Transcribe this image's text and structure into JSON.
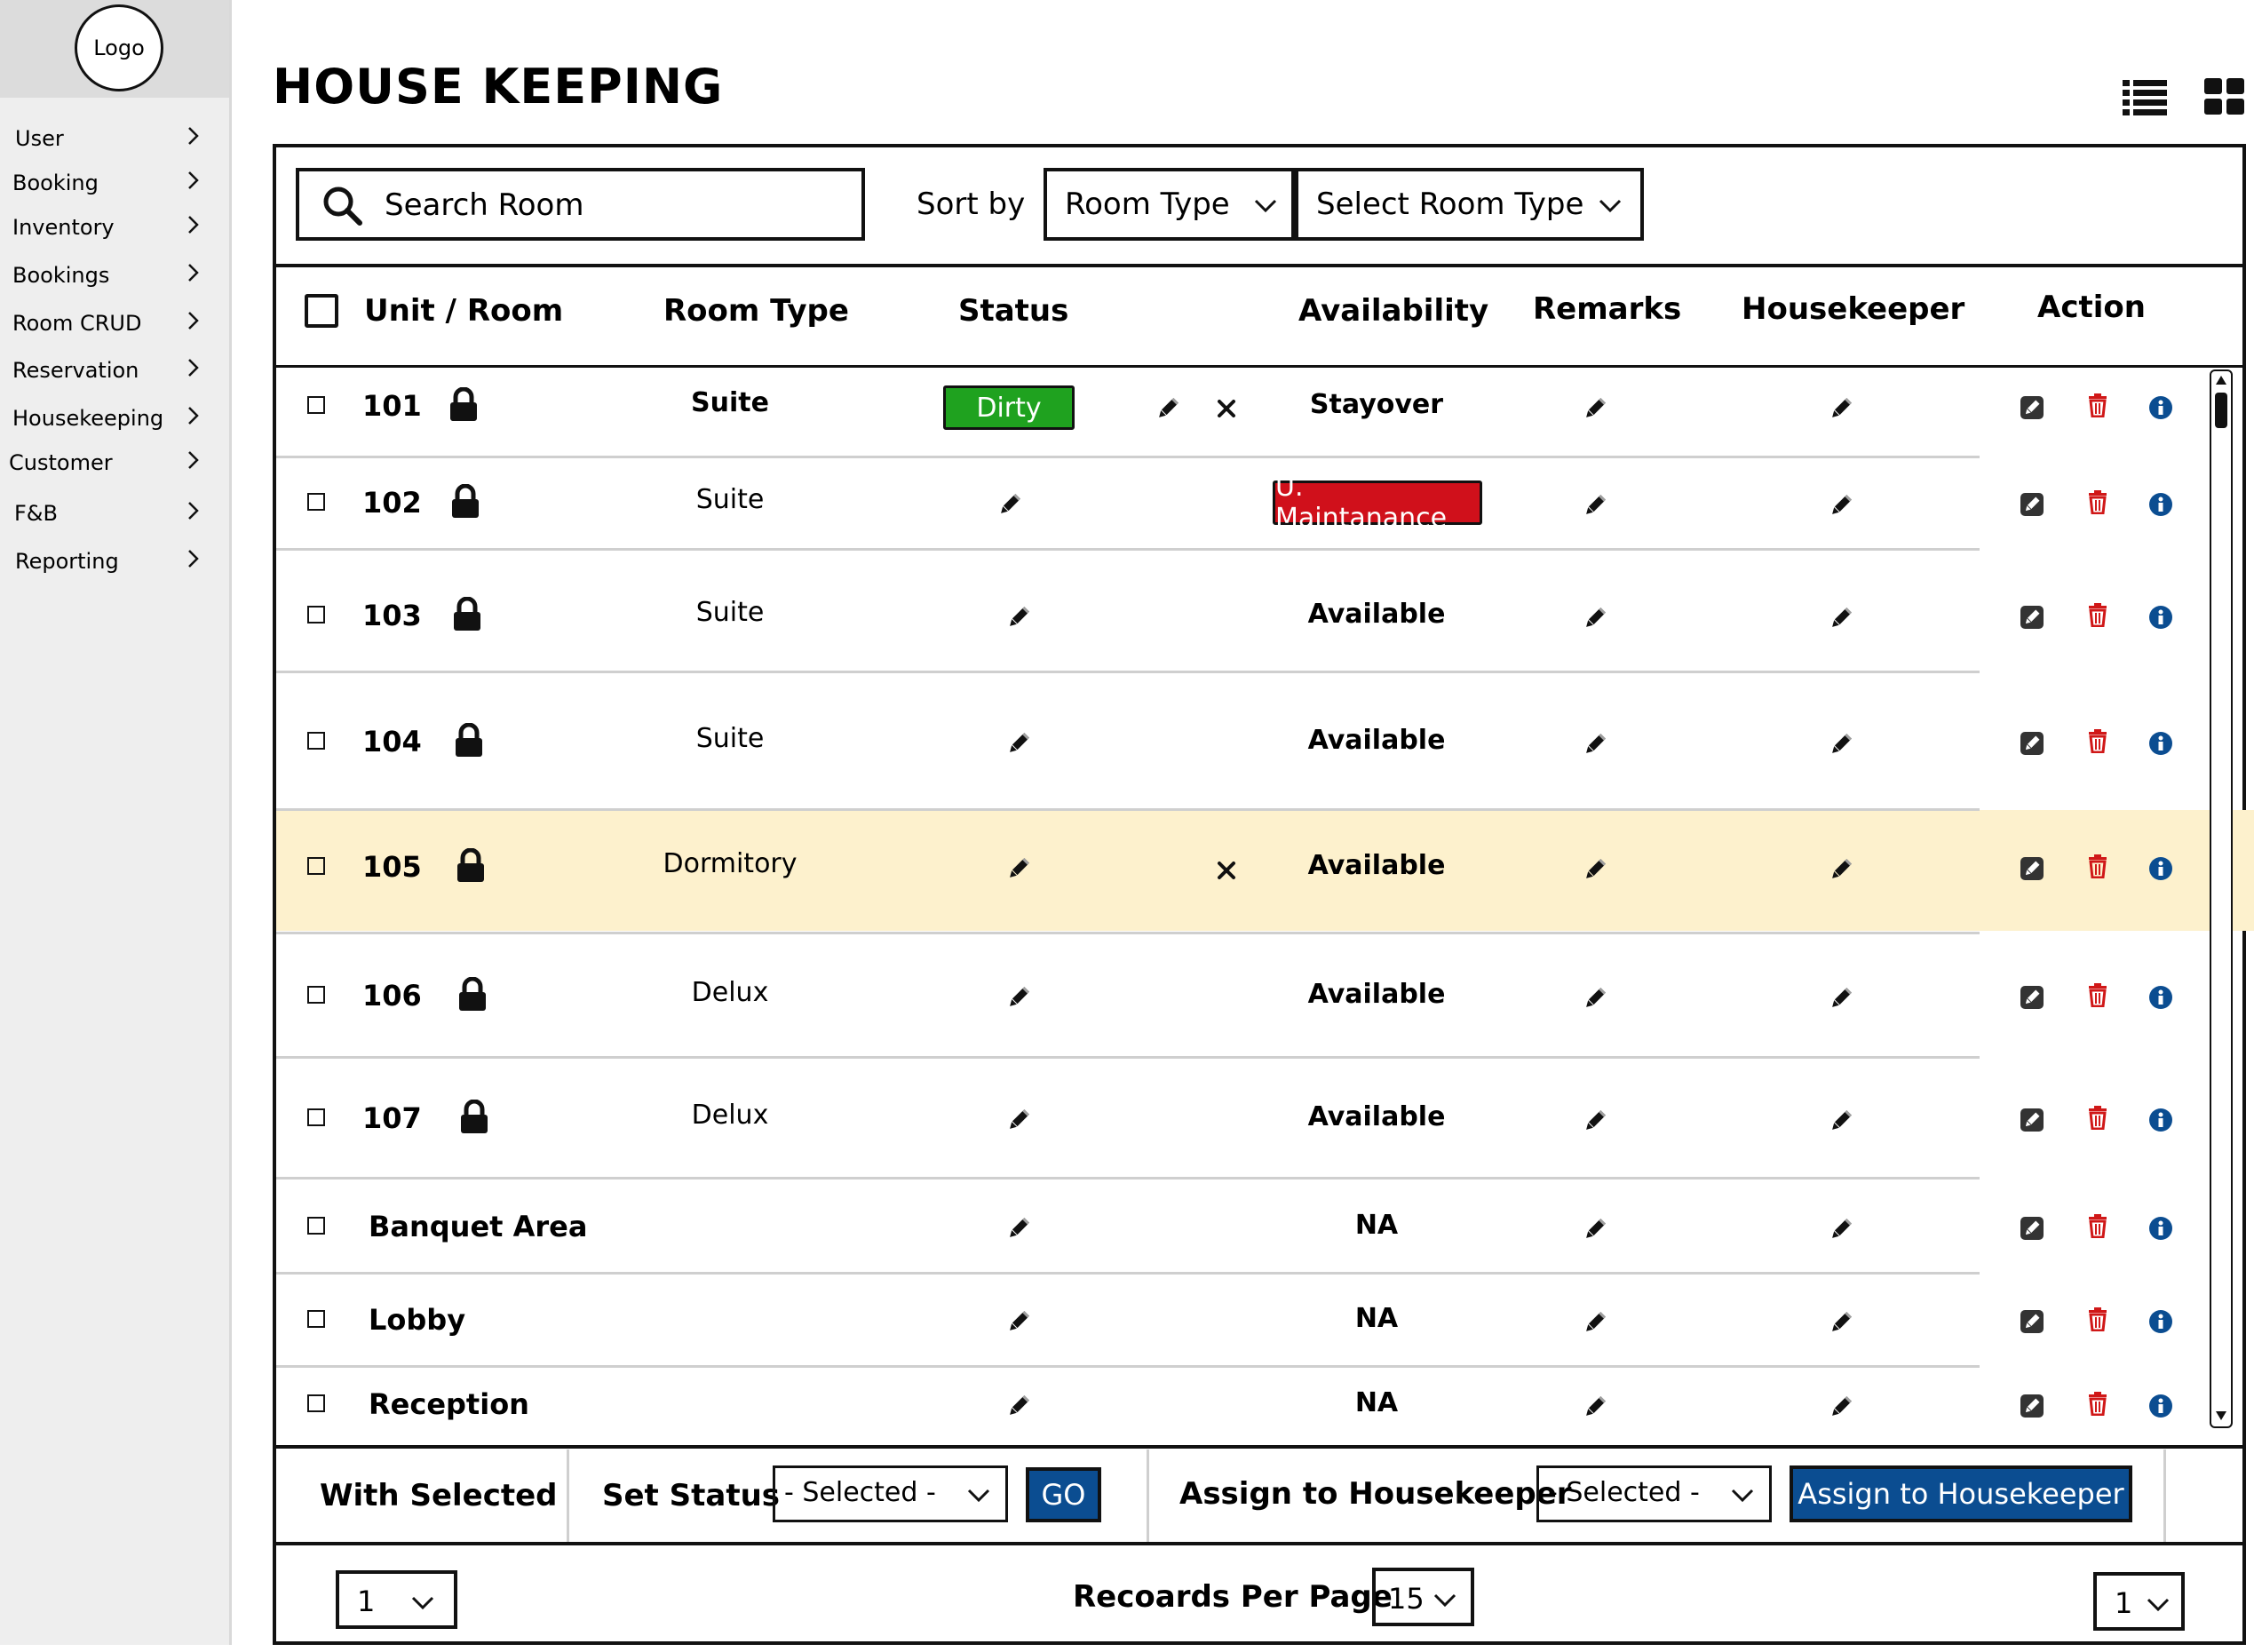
{
  "logo": {
    "label": "Logo"
  },
  "sidebar": {
    "items": [
      {
        "label": "User"
      },
      {
        "label": "Booking"
      },
      {
        "label": "Inventory"
      },
      {
        "label": "Bookings"
      },
      {
        "label": "Room CRUD"
      },
      {
        "label": "Reservation"
      },
      {
        "label": "Housekeeping"
      },
      {
        "label": "Customer"
      },
      {
        "label": "F&B"
      },
      {
        "label": "Reporting"
      }
    ]
  },
  "header": {
    "title": "HOUSE KEEPING",
    "view_icons": [
      "list-view-icon",
      "grid-view-icon"
    ]
  },
  "toolbar": {
    "search_placeholder": "Search Room",
    "sort_label": "Sort by",
    "sort_select": "Room Type",
    "room_type_select": "Select Room Type"
  },
  "table": {
    "columns": [
      "Unit / Room",
      "Room Type",
      "Status",
      "Availability",
      "Remarks",
      "Housekeeper",
      "Action"
    ],
    "rows": [
      {
        "unit": "101",
        "type": "Suite",
        "status": "Dirty",
        "availability": "Stayover"
      },
      {
        "unit": "102",
        "type": "Suite",
        "status": "",
        "availability": "U. Maintanance"
      },
      {
        "unit": "103",
        "type": "Suite",
        "status": "",
        "availability": "Available"
      },
      {
        "unit": "104",
        "type": "Suite",
        "status": "",
        "availability": "Available"
      },
      {
        "unit": "105",
        "type": "Dormitory",
        "status": "",
        "availability": "Available"
      },
      {
        "unit": "106",
        "type": "Delux",
        "status": "",
        "availability": "Available"
      },
      {
        "unit": "107",
        "type": "Delux",
        "status": "",
        "availability": "Available"
      },
      {
        "unit": "Banquet Area",
        "type": "",
        "status": "",
        "availability": "NA"
      },
      {
        "unit": "Lobby",
        "type": "",
        "status": "",
        "availability": "NA"
      },
      {
        "unit": "Reception",
        "type": "",
        "status": "",
        "availability": "NA"
      }
    ],
    "highlighted_row": "105"
  },
  "footer": {
    "with_selected": "With Selected",
    "set_status": "Set Status",
    "status_select": "- Selected -",
    "go_label": "GO",
    "assign_label": "Assign to Housekeeper",
    "housekeeper_select": "- Selected -",
    "assign_button": "Assign to Housekeeper",
    "page_left": "1",
    "records_label": "Recoards Per Page",
    "records_value": "15",
    "page_right": "1"
  },
  "colors": {
    "dirty": "#1fa21f",
    "maintenance": "#d0101b",
    "highlight": "#fdf1cd",
    "primary_button": "#0b4d91",
    "delete_icon": "#d01818",
    "info_icon": "#0b4d91"
  }
}
